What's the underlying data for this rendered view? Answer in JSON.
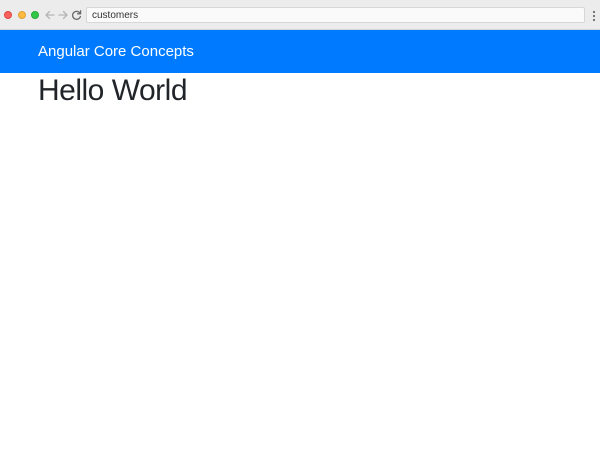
{
  "browser": {
    "address_bar_text": "customers",
    "icons": {
      "back": "arrow-left-icon",
      "forward": "arrow-right-icon",
      "reload": "reload-icon",
      "menu": "kebab-menu-icon"
    },
    "colors": {
      "close": "#fc605b",
      "minimize": "#fdbc40",
      "maximize": "#34c84a"
    }
  },
  "navbar": {
    "brand": "Angular Core Concepts",
    "background": "#007bff"
  },
  "main": {
    "heading": "Hello World"
  }
}
